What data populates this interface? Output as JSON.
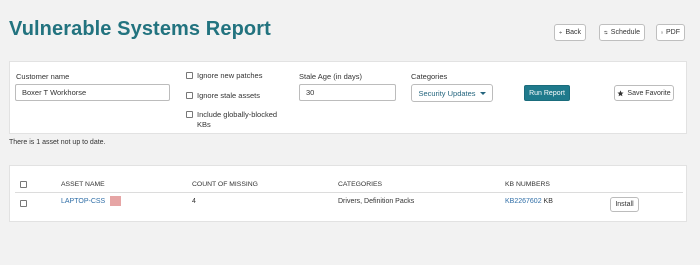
{
  "header": {
    "title": "Vulnerable Systems Report",
    "back_label": "Back",
    "schedule_label": "Schedule",
    "pdf_label": "PDF"
  },
  "filters": {
    "customer_name_label": "Customer name",
    "customer_name_value": "Boxer T Workhorse",
    "ignore_new_patches_label": "Ignore new patches",
    "ignore_stale_assets_label": "Ignore stale assets",
    "include_blocked_label_line1": "Include globally-blocked",
    "include_blocked_label_line2": "KBs",
    "stale_age_label": "Stale Age (in days)",
    "stale_age_value": "30",
    "categories_label": "Categories",
    "categories_selected": "Security Updates",
    "run_report_label": "Run Report",
    "save_favorite_label": "Save Favorite"
  },
  "status": "There is 1 asset not up to date.",
  "table": {
    "columns": [
      "ASSET NAME",
      "COUNT OF MISSING",
      "CATEGORIES",
      "KB NUMBERS"
    ],
    "rows": [
      {
        "asset_name": "LAPTOP-CSS",
        "count_missing": "4",
        "categories": "Drivers, Definition Packs",
        "kb_link": "KB2267602",
        "kb_suffix": " KB",
        "action": "Install"
      }
    ]
  },
  "colors": {
    "title": "#22737f",
    "primary_button": "#1f7a8c",
    "link": "#2f6ea7",
    "asset_swatch": "#e6a5a5"
  }
}
